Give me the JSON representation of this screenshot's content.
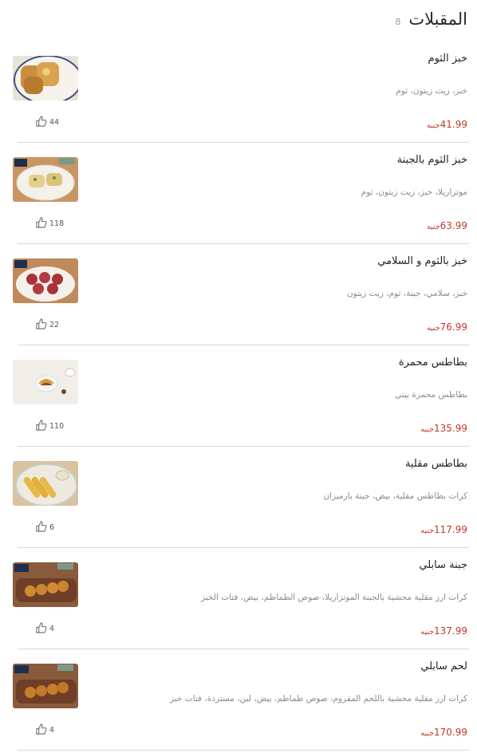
{
  "header": {
    "title": "المقبلات",
    "count": "8"
  },
  "items": [
    {
      "name": "خبز الثوم",
      "desc": "خبز، زيت زيتون، ثوم",
      "price": "41.99",
      "currency": "جنيه",
      "likes": "44"
    },
    {
      "name": "خبز الثوم بالجبنة",
      "desc": "موتزاريلا، خبز، زيت زيتون، ثوم",
      "price": "63.99",
      "currency": "جنيه",
      "likes": "118"
    },
    {
      "name": "خبز بالثوم و السلامي",
      "desc": "خبز، سلامي، جبنة، ثوم، زيت زيتون",
      "price": "76.99",
      "currency": "جنيه",
      "likes": "22"
    },
    {
      "name": "بطاطس محمرة",
      "desc": "بطاطس محمرة بيتي",
      "price": "135.99",
      "currency": "جنيه",
      "likes": "110"
    },
    {
      "name": "بطاطس مقلية",
      "desc": "كرات بطاطس مقلية، بيض، جبنة بارميزان",
      "price": "117.99",
      "currency": "جنيه",
      "likes": "6"
    },
    {
      "name": "جبنة سابلي",
      "desc": "كرات ارز مقلية محشية بالجبنة الموتزاريلا، صوص الطماطم، بيض، فتات الخبز",
      "price": "137.99",
      "currency": "جنيه",
      "likes": "4"
    },
    {
      "name": "لحم سابلي",
      "desc": "كرات ارز مقلية محشية باللحم المفروم، صوص طماطم، بيض، لبن، مستردة، فتات خبز",
      "price": "170.99",
      "currency": "جنيه",
      "likes": "4"
    }
  ]
}
